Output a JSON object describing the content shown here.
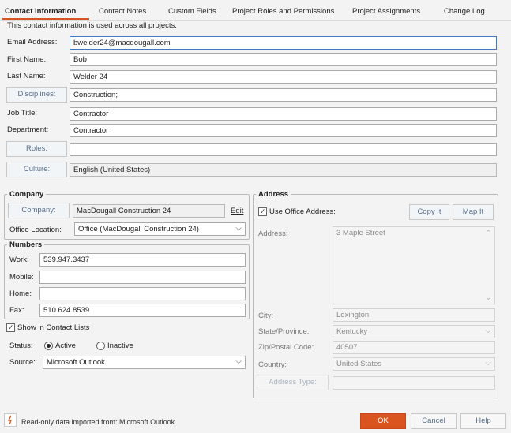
{
  "tabs": {
    "contact_information": "Contact Information",
    "contact_notes": "Contact Notes",
    "custom_fields": "Custom Fields",
    "project_roles": "Project Roles and Permissions",
    "project_assignments": "Project Assignments",
    "change_log": "Change Log"
  },
  "info_text": "This contact information is used across all projects.",
  "contact": {
    "email_label": "Email Address:",
    "email_value": "bwelder24@macdougall.com",
    "first_name_label": "First Name:",
    "first_name_value": "Bob",
    "last_name_label": "Last Name:",
    "last_name_value": "Welder 24",
    "disciplines_button": "Disciplines:",
    "disciplines_value": "Construction;",
    "job_title_label": "Job Title:",
    "job_title_value": "Contractor",
    "department_label": "Department:",
    "department_value": "Contractor",
    "roles_button": "Roles:",
    "roles_value": "",
    "culture_button": "Culture:",
    "culture_value": "English (United States)"
  },
  "company": {
    "title": "Company",
    "company_button": "Company:",
    "company_value": "MacDougall Construction 24",
    "edit_link": "Edit",
    "office_location_label": "Office Location:",
    "office_location_value": "Office (MacDougall Construction 24)"
  },
  "numbers": {
    "title": "Numbers",
    "work_label": "Work:",
    "work_value": "539.947.3437",
    "mobile_label": "Mobile:",
    "mobile_value": "",
    "home_label": "Home:",
    "home_value": "",
    "fax_label": "Fax:",
    "fax_value": "510.624.8539"
  },
  "options": {
    "show_in_contact_lists": "Show in Contact Lists",
    "show_in_contact_lists_checked": true,
    "status_label": "Status:",
    "status_active": "Active",
    "status_inactive": "Inactive",
    "status_selected": "Active",
    "source_label": "Source:",
    "source_value": "Microsoft Outlook"
  },
  "address": {
    "title": "Address",
    "use_office_address": "Use Office Address:",
    "use_office_address_checked": true,
    "copy_it": "Copy It",
    "map_it": "Map It",
    "address_label": "Address:",
    "address_value": "3 Maple Street",
    "city_label": "City:",
    "city_value": "Lexington",
    "state_label": "State/Province:",
    "state_value": "Kentucky",
    "zip_label": "Zip/Postal Code:",
    "zip_value": "40507",
    "country_label": "Country:",
    "country_value": "United States",
    "address_type_button": "Address Type:",
    "address_type_value": ""
  },
  "footer": {
    "readonly_notice": "Read-only data imported from: Microsoft Outlook",
    "ok": "OK",
    "cancel": "Cancel",
    "help": "Help"
  },
  "icons": {
    "check": "✓",
    "chevron_down": "⌵",
    "scroll_up": "⌃",
    "scroll_down": "⌄"
  },
  "colors": {
    "accent": "#d9541e",
    "button_text": "#5a6f8a",
    "focus_border": "#3d7bbf"
  }
}
